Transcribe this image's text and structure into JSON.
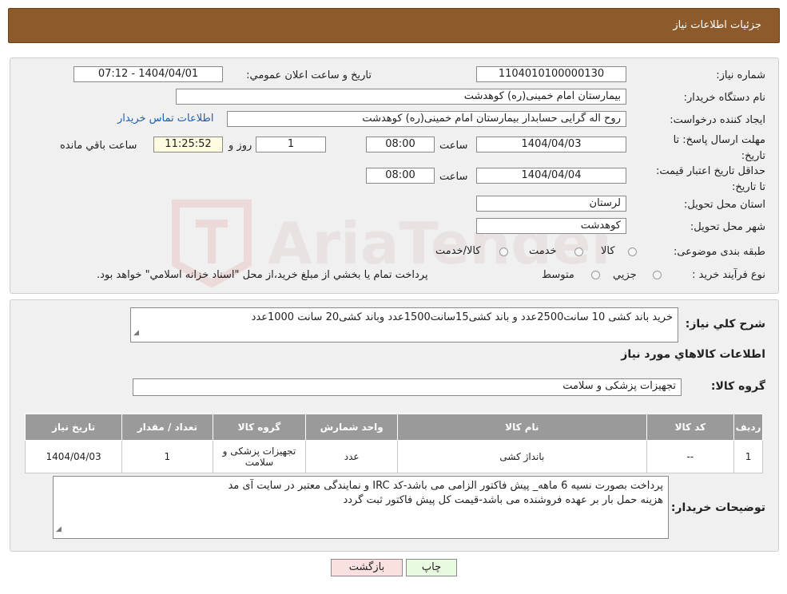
{
  "header": {
    "title": "جزئيات اطلاعات نياز"
  },
  "form": {
    "need_number_label": "شماره نياز:",
    "need_number": "1104010100000130",
    "announce_label": "تاريخ و ساعت اعلان عمومي:",
    "announce_value": "1404/04/01 - 07:12",
    "buyer_org_label": "نام دستگاه خريدار:",
    "buyer_org": "بیمارستان امام خمینی(ره) کوهدشت",
    "creator_label": "ايجاد كننده درخواست:",
    "creator": "روح اله گرایی حسابدار بیمارستان امام خمینی(ره) کوهدشت",
    "contact_link": "اطلاعات تماس خريدار",
    "reply_deadline_label": "مهلت ارسال پاسخ: تا تاريخ:",
    "reply_date": "1404/04/03",
    "time_label": "ساعت",
    "reply_time": "08:00",
    "days_value": "1",
    "days_label": "روز و",
    "remaining_time": "11:25:52",
    "remaining_label": "ساعت باقي مانده",
    "validity_label": "حداقل تاريخ اعتبار قيمت: تا تاريخ:",
    "validity_date": "1404/04/04",
    "validity_time_label": "ساعت",
    "validity_time": "08:00",
    "province_label": "استان محل تحويل:",
    "province": "لرستان",
    "city_label": "شهر محل تحويل:",
    "city": "کوهدشت",
    "category_label": "طبقه بندی موضوعی:",
    "category_options": [
      "كالا",
      "خدمت",
      "كالا/خدمت"
    ],
    "process_label": "نوع فرآيند خريد :",
    "process_options": [
      "جزيي",
      "متوسط"
    ],
    "process_note": "پرداخت تمام يا بخشي از مبلغ خريد،از محل \"اسناد خزانه اسلامي\" خواهد بود."
  },
  "summary": {
    "desc_label": "شرح كلي نياز:",
    "desc_value": "خرید باند کشی 10 سانت2500عدد و باند کشی15سانت1500عدد وباند کشی20 سانت 1000عدد",
    "items_title": "اطلاعات كالاهاي مورد نياز",
    "group_label": "گروه كالا:",
    "group_value": "تجهیزات پزشکی و سلامت"
  },
  "table": {
    "headers": [
      "رديف",
      "كد كالا",
      "نام كالا",
      "واحد شمارش",
      "گروه كالا",
      "تعداد / مقدار",
      "تاريخ نياز"
    ],
    "rows": [
      [
        "1",
        "--",
        "بانداژ کشی",
        "عدد",
        "تجهیزات پزشکی و سلامت",
        "1",
        "1404/04/03"
      ]
    ]
  },
  "buyer_notes": {
    "label": "توضيحات خريدار:",
    "line1": "پرداخت بصورت نسیه 6 ماهه_ پیش فاکتور  الزامی می باشد-کد IRC و نمایندگی معتبر در سایت آی مد",
    "line2": "هزینه حمل بار بر عهده فروشنده می باشد-قیمت کل پیش فاکتور ثبت گردد"
  },
  "buttons": {
    "print": "چاپ",
    "back": "بازگشت"
  },
  "watermark": {
    "text": "AriaTender.net"
  },
  "colors": {
    "header_bg": "#8d5a2b",
    "table_header_bg": "#9a9a9a",
    "print_btn": "#e8fbe0",
    "back_btn": "#fbe0e0",
    "remaining_bg": "#fffbe0"
  }
}
